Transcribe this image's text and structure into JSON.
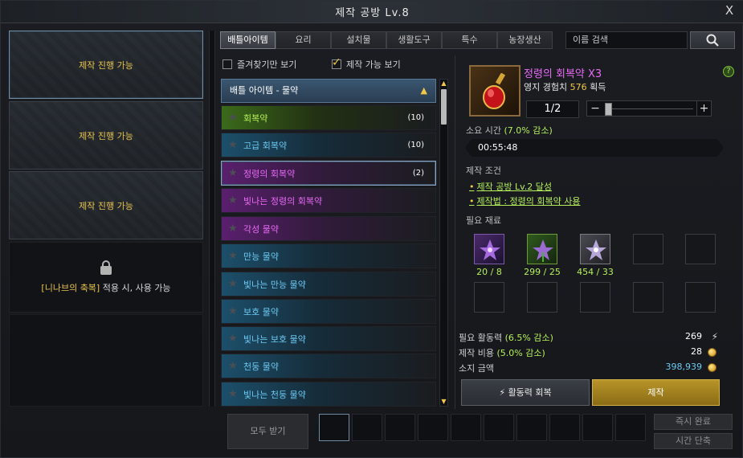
{
  "window": {
    "title": "제작 공방 Lv.8",
    "close_label": "X"
  },
  "slots": [
    {
      "label": "제작 진행 가능"
    },
    {
      "label": "제작 진행 가능"
    },
    {
      "label": "제작 진행 가능"
    }
  ],
  "locked_slot": {
    "blessing": "[니나브의 축복]",
    "suffix": " 적용 시, 사용 가능"
  },
  "tabs": [
    "배틀아이템",
    "요리",
    "설치물",
    "생활도구",
    "특수",
    "농장생산"
  ],
  "search": {
    "placeholder": "이름 검색"
  },
  "filters": {
    "favorites_label": "즐겨찾기만 보기",
    "craftable_label": "제작 가능 보기"
  },
  "list": {
    "header": "배틀 아이템 - 물약",
    "items": [
      {
        "name": "회복약",
        "count": "(10)",
        "grade": "green"
      },
      {
        "name": "고급 회복약",
        "count": "(10)",
        "grade": "blue"
      },
      {
        "name": "정령의 회복약",
        "count": "(2)",
        "grade": "purple"
      },
      {
        "name": "빛나는 정령의 회복약",
        "count": "",
        "grade": "purple"
      },
      {
        "name": "각성 물약",
        "count": "",
        "grade": "purple"
      },
      {
        "name": "만능 물약",
        "count": "",
        "grade": "blue"
      },
      {
        "name": "빛나는 만능 물약",
        "count": "",
        "grade": "blue"
      },
      {
        "name": "보호 물약",
        "count": "",
        "grade": "blue"
      },
      {
        "name": "빛나는 보호 물약",
        "count": "",
        "grade": "blue"
      },
      {
        "name": "천둥 물약",
        "count": "",
        "grade": "blue"
      },
      {
        "name": "빛나는 천둥 물약",
        "count": "",
        "grade": "blue"
      }
    ]
  },
  "detail": {
    "title": "정령의 회복약 X3",
    "exp_prefix": "영지 경험치 ",
    "exp_value": "576",
    "exp_suffix": " 획득",
    "help_label": "?",
    "quantity": "1/2",
    "quantity_fraction": 0.5,
    "time_label": "소요 시간 ",
    "time_reduction": "(7.0% 감소)",
    "time_value": "00:55:48",
    "conditions_label": "제작 조건",
    "conditions": [
      "제작 공방 Lv.2 달성",
      "제작법 : 정령의 회복약 사용"
    ],
    "materials_label": "필요 재료",
    "materials": [
      {
        "icon": "purple-flower-icon",
        "count": "20 / 8"
      },
      {
        "icon": "green-flower-icon",
        "count": "299 / 25"
      },
      {
        "icon": "grey-flower-icon",
        "count": "454 / 33"
      }
    ],
    "energy_label": "필요 활동력 ",
    "energy_reduction": "(6.5% 감소)",
    "energy_value": "269",
    "cost_label": "제작 비용 ",
    "cost_reduction": "(5.0% 감소)",
    "cost_value": "28",
    "gold_label": "소지 금액",
    "gold_value": "398,939",
    "recover_button": "활동력 회복",
    "craft_button": "제작"
  },
  "bottom": {
    "receive_all": "모두 받기",
    "instant_complete": "즉시 완료",
    "time_reduce": "시간 단축"
  },
  "colors": {
    "accent_gold": "#f0c74a",
    "grade_green": "#b6f05a",
    "grade_blue": "#6cc9f2",
    "grade_purple": "#e86bf5"
  }
}
